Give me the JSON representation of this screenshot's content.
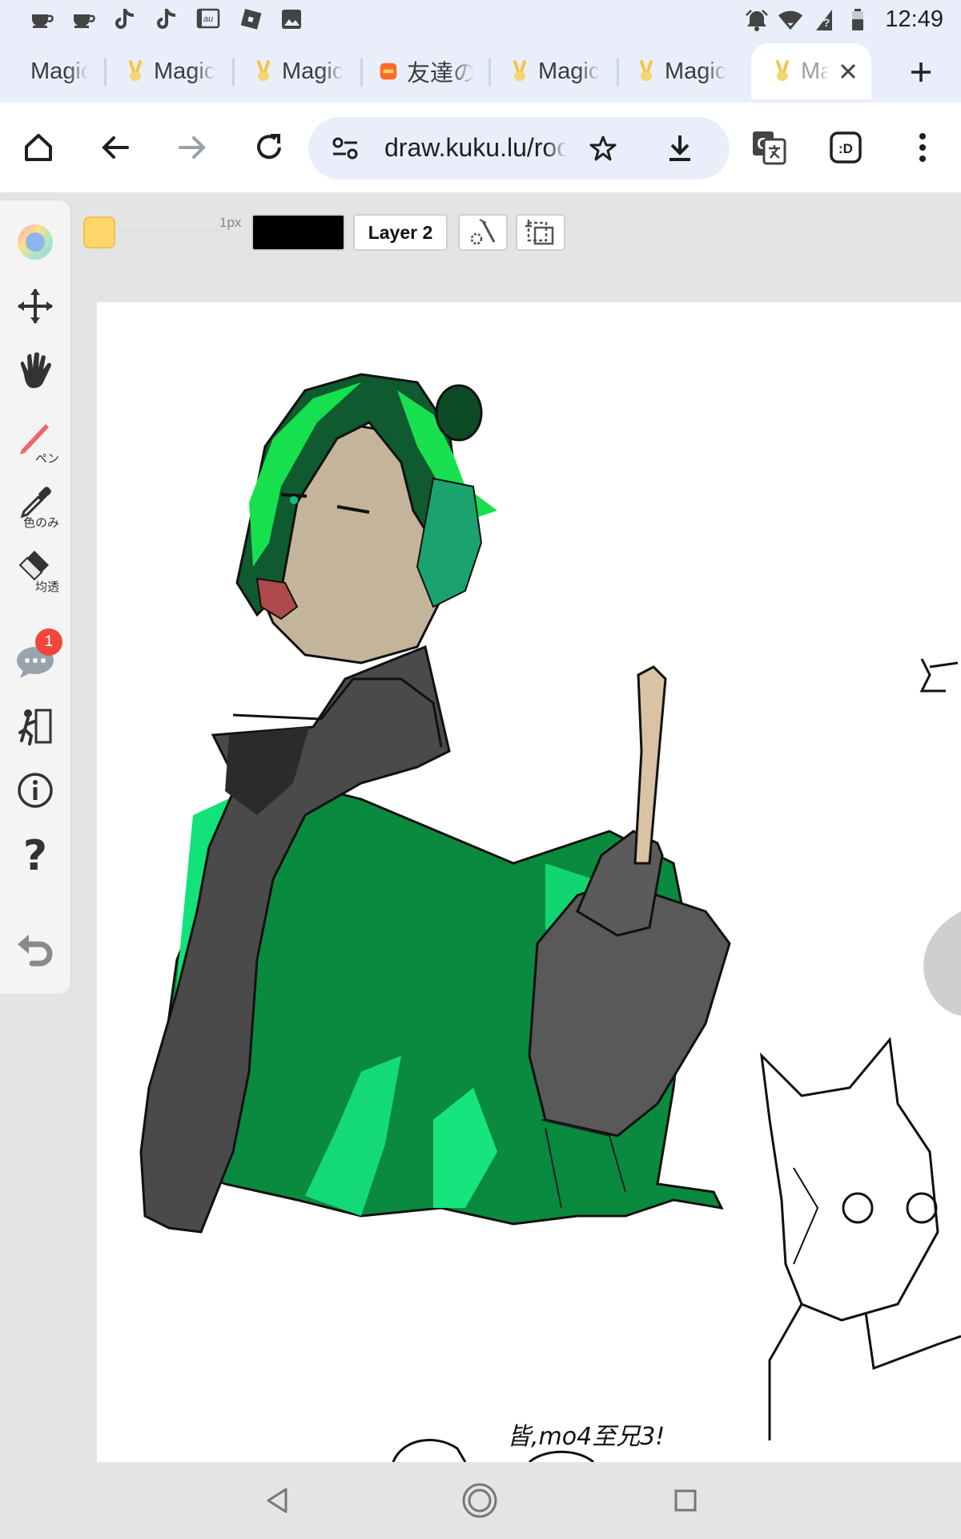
{
  "status_bar": {
    "time": "12:49",
    "left_icons": [
      "cup-icon",
      "cup-icon",
      "tiktok-icon",
      "tiktok-icon",
      "au-icon",
      "roblox-icon",
      "image-icon"
    ],
    "right_icons": [
      "alarm-icon",
      "wifi-icon",
      "signal-icon",
      "battery-icon"
    ]
  },
  "tabs": [
    {
      "label": "Magic",
      "favicon": "none"
    },
    {
      "label": "Magic",
      "favicon": "bunny-favicon"
    },
    {
      "label": "Magic",
      "favicon": "bunny-favicon"
    },
    {
      "label": "友達の",
      "favicon": "orange-favicon"
    },
    {
      "label": "Magic",
      "favicon": "bunny-favicon"
    },
    {
      "label": "Magic",
      "favicon": "bunny-favicon"
    },
    {
      "label": "Magic",
      "favicon": "bunny-favicon",
      "active": true
    }
  ],
  "toolbar": {
    "url": "draw.kuku.lu/room"
  },
  "app": {
    "brush_size_label": "1px",
    "layer_label": "Layer 2",
    "current_color": "#000000",
    "swatch_color": "#ffd66b",
    "sidebar": {
      "pen_label": "ペン",
      "eyedropper_label": "色のみ",
      "eraser_label": "均透",
      "chat_badge": "1"
    },
    "canvas": {
      "handwritten_note": "皆,mo4至兄3!"
    }
  },
  "colors": {
    "accent_green": "#0a8a3e",
    "light_green": "#12e27a",
    "badge_red": "#f0463c"
  }
}
